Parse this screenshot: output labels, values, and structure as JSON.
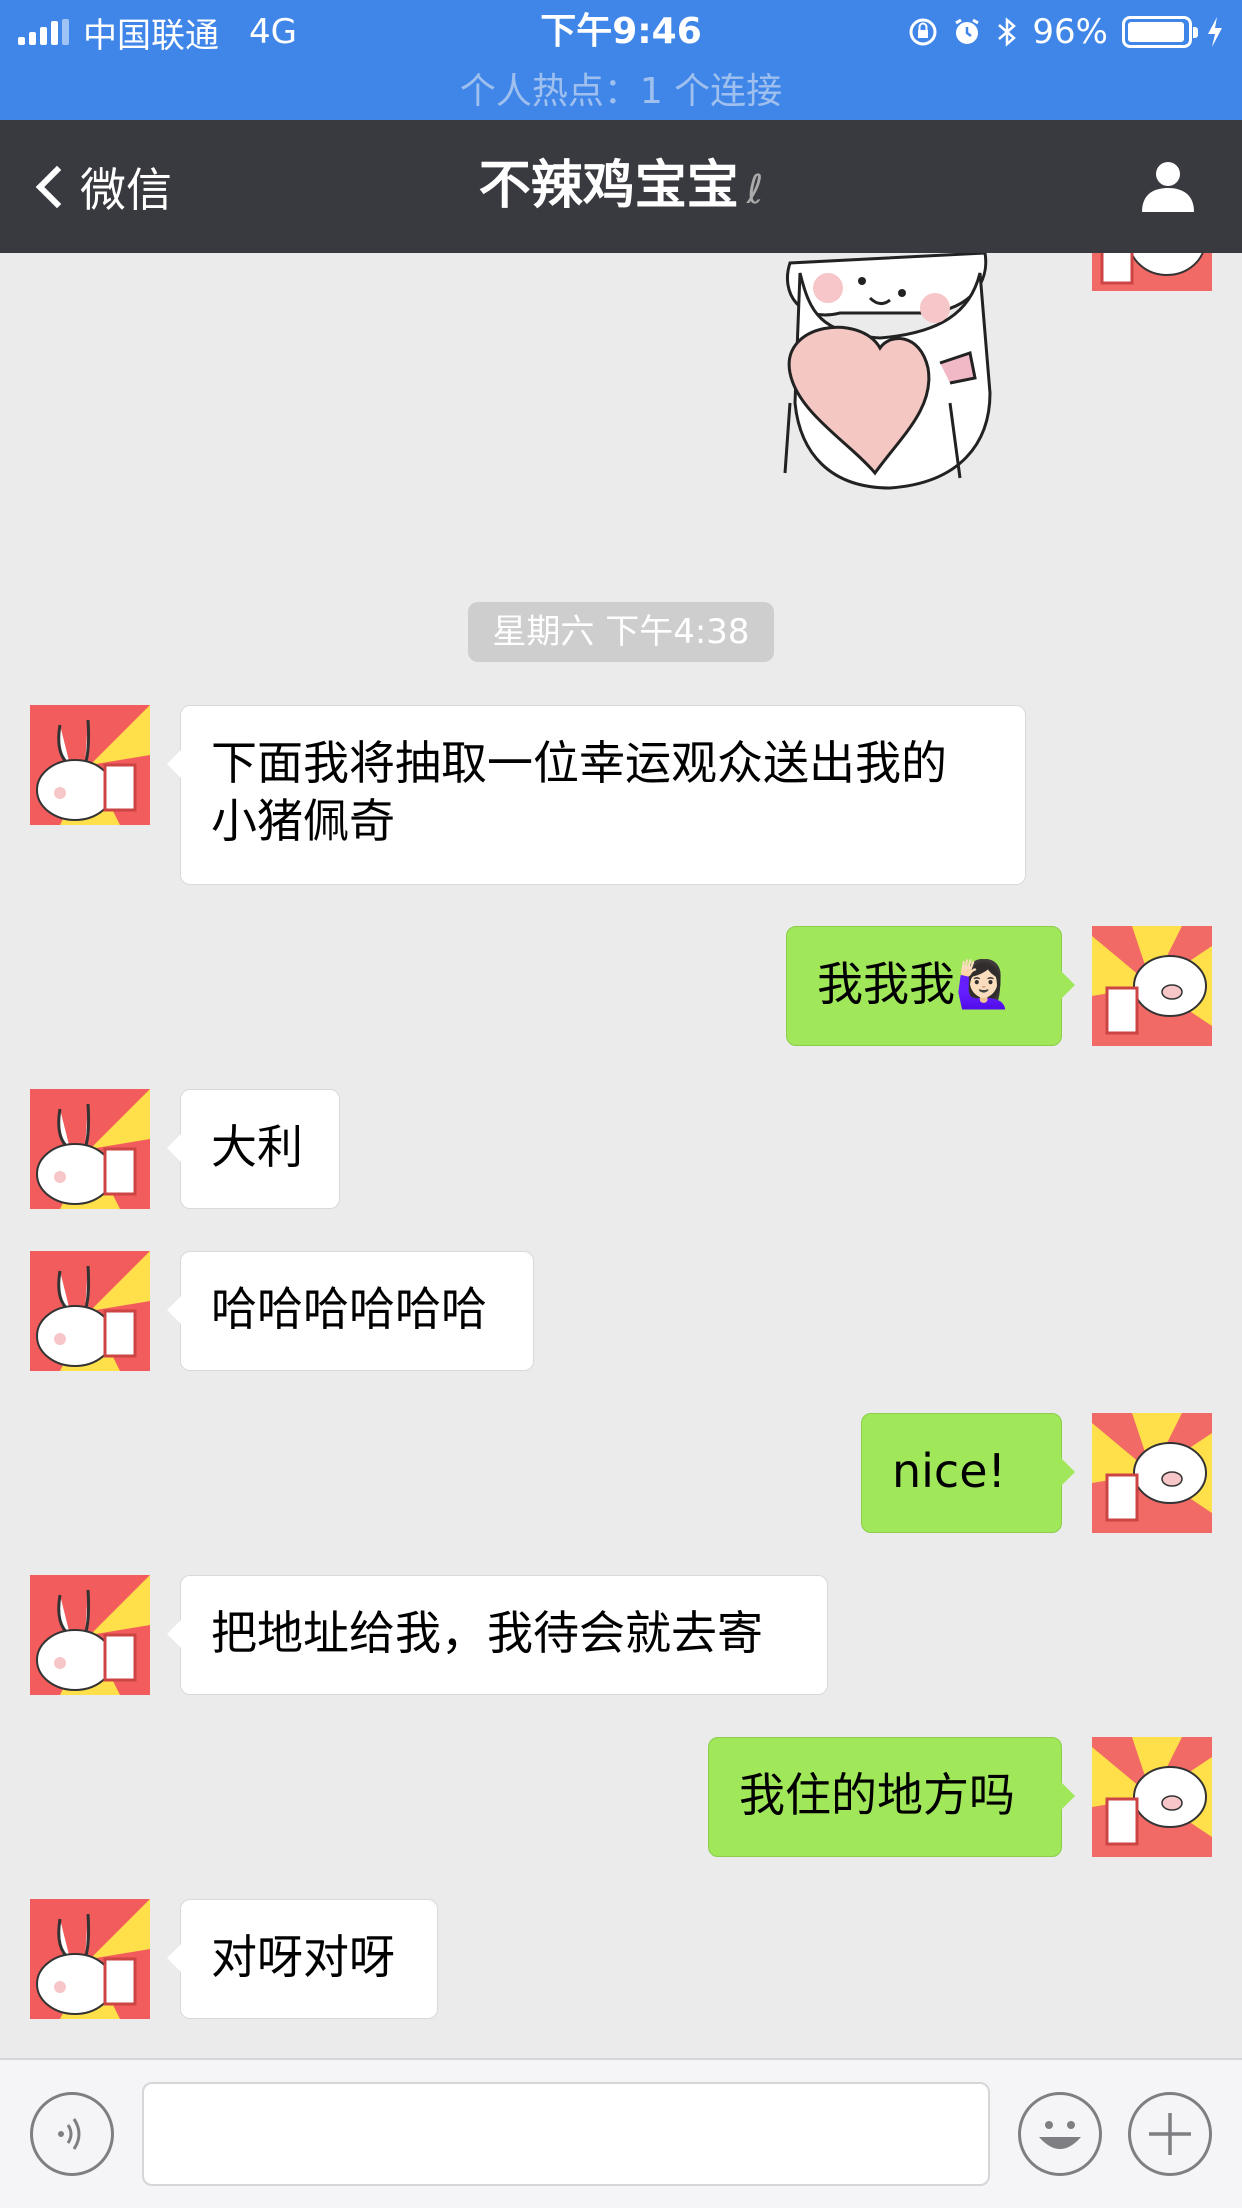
{
  "status_bar": {
    "carrier": "中国联通",
    "network": "4G",
    "time": "下午9:46",
    "battery_percent": "96%",
    "battery_level": 0.96,
    "hotspot": "个人热点：1 个连接"
  },
  "nav": {
    "back_label": "微信",
    "title": "不辣鸡宝宝"
  },
  "chat": {
    "timestamp": "星期六 下午4:38",
    "messages": [
      {
        "from": "them",
        "text": "下面我将抽取一位幸运观众送出我的\n小猪佩奇"
      },
      {
        "from": "me",
        "text": "我我我🙋🏻‍♀️"
      },
      {
        "from": "them",
        "text": "大利"
      },
      {
        "from": "them",
        "text": "哈哈哈哈哈哈"
      },
      {
        "from": "me",
        "text": "nice!"
      },
      {
        "from": "them",
        "text": "把地址给我，我待会就去寄"
      },
      {
        "from": "me",
        "text": "我住的地方吗"
      },
      {
        "from": "them",
        "text": "对呀对呀"
      }
    ]
  },
  "input": {
    "placeholder": ""
  },
  "colors": {
    "status_bar": "#3f86e8",
    "nav_bar": "#393a3f",
    "chat_bg": "#ebebeb",
    "outgoing_bubble": "#a0e75a",
    "incoming_bubble": "#ffffff"
  }
}
